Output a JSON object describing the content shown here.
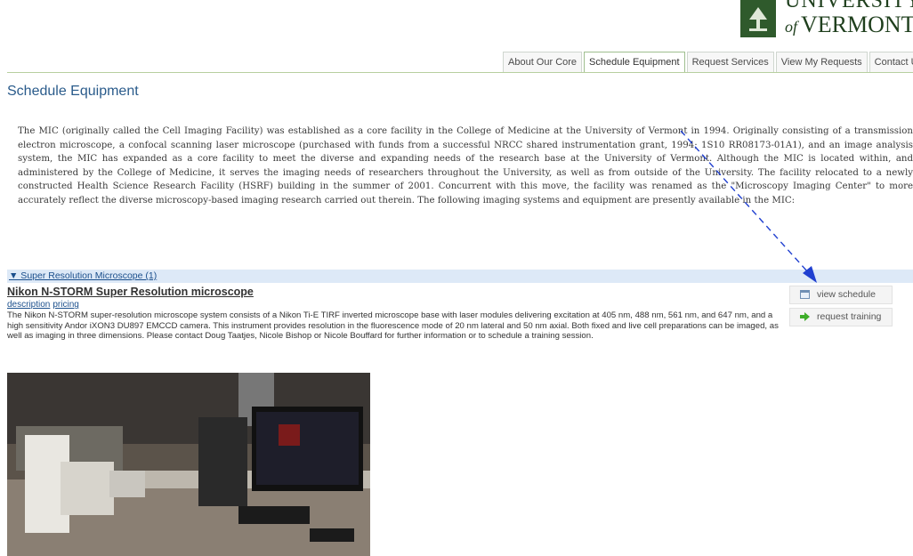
{
  "logo": {
    "line1": "UNIVERSITY",
    "of": "of",
    "line2": "VERMONT"
  },
  "nav": {
    "tabs": [
      "About Our Core",
      "Schedule Equipment",
      "Request Services",
      "View My Requests",
      "Contact Us"
    ]
  },
  "page_title": "Schedule Equipment",
  "intro": "The MIC (originally called the Cell Imaging Facility) was established as a core facility in the College of Medicine at the University of Vermont in 1994. Originally consisting of a transmission electron microscope, a confocal scanning laser microscope (purchased with funds from a successful NRCC shared instrumentation grant, 1994; 1S10 RR08173-01A1), and an image analysis system, the MIC has expanded as a core facility to meet the diverse and expanding needs of the research base at the University of Vermont. Although the MIC is located within, and administered by the College of Medicine, it serves the imaging needs of researchers throughout the University, as well as from outside of the University. The facility relocated to a newly constructed Health Science Research Facility (HSRF) building in the summer of 2001. Concurrent with this move, the facility was renamed as the \"Microscopy Imaging Center\" to more accurately reflect the diverse microscopy-based imaging research carried out therein. The following imaging systems and equipment are presently available in the MIC:",
  "category": {
    "label": "▼ Super Resolution Microscope (1)"
  },
  "equipment": {
    "name": "Nikon N-STORM Super Resolution microscope",
    "link_description": "description",
    "link_pricing": "pricing",
    "description": "The Nikon N-STORM super-resolution microscope system consists of a Nikon Ti-E  TIRF inverted microscope base with laser modules delivering excitation at 405 nm, 488 nm, 561 nm, and 647 nm, and a high sensitivity Andor iXON3 DU897 EMCCD camera. This instrument provides resolution in the fluorescence mode of 20 nm lateral and 50 nm axial. Both fixed and live cell preparations can be imaged, as well as imaging in three dimensions. Please contact Doug Taatjes, Nicole Bishop or Nicole Bouffard for further information or to schedule a training session.",
    "view_schedule": "view schedule",
    "request_training": "request training"
  },
  "icons": {
    "calendar": "calendar-icon",
    "arrow": "green-arrow-icon",
    "annotation": "dashed-arrow-annotation"
  },
  "colors": {
    "title": "#2a5b8b",
    "category_bar": "#dde9f7",
    "link": "#1b4f8c",
    "annotation": "#1f3fd0"
  }
}
